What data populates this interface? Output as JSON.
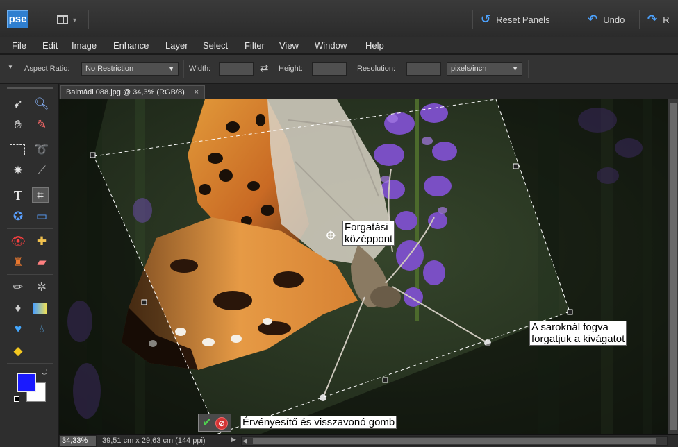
{
  "app": {
    "logo": "pse",
    "layout_icon": "layout-grid-icon"
  },
  "toolbar": {
    "reset_panels": "Reset Panels",
    "undo": "Undo",
    "redo": "R"
  },
  "menu": [
    "File",
    "Edit",
    "Image",
    "Enhance",
    "Layer",
    "Select",
    "Filter",
    "View",
    "Window",
    "Help"
  ],
  "options": {
    "aspect_ratio_label": "Aspect Ratio:",
    "aspect_ratio_value": "No Restriction",
    "width_label": "Width:",
    "width_value": "",
    "height_label": "Height:",
    "height_value": "",
    "resolution_label": "Resolution:",
    "resolution_value": "",
    "resolution_unit": "pixels/inch"
  },
  "document": {
    "tab_title": "Balmádi 088.jpg @ 34,3% (RGB/8)",
    "close": "×"
  },
  "tools": [
    "move-icon",
    "zoom-icon",
    "hand-icon",
    "eyedropper-icon",
    "marquee-icon",
    "lasso-icon",
    "magic-wand-icon",
    "quick-selection-icon",
    "type-icon",
    "crop-icon",
    "cookie-cutter-icon",
    "straighten-icon",
    "red-eye-icon",
    "healing-brush-icon",
    "clone-stamp-icon",
    "eraser-icon",
    "brush-icon",
    "impressionist-brush-icon",
    "paint-bucket-icon",
    "gradient-icon",
    "custom-shape-icon",
    "blur-icon",
    "sponge-icon"
  ],
  "colors": {
    "foreground": "#1a1aff",
    "background": "#ffffff",
    "accent": "#4da3ff"
  },
  "annotations": {
    "rotation_center": [
      "Forgatási",
      "középpont"
    ],
    "corner_rotate": [
      "A saroknál fogva",
      "forgatjuk a kivágatot"
    ],
    "commit_cancel": "Érvényesítő és visszavonó gomb"
  },
  "commit": {
    "ok": "✔",
    "cancel": "⊘"
  },
  "status": {
    "zoom": "34,33%",
    "doc_info": "39,51 cm x 29,63 cm (144 ppi)",
    "arrow": "▶"
  }
}
